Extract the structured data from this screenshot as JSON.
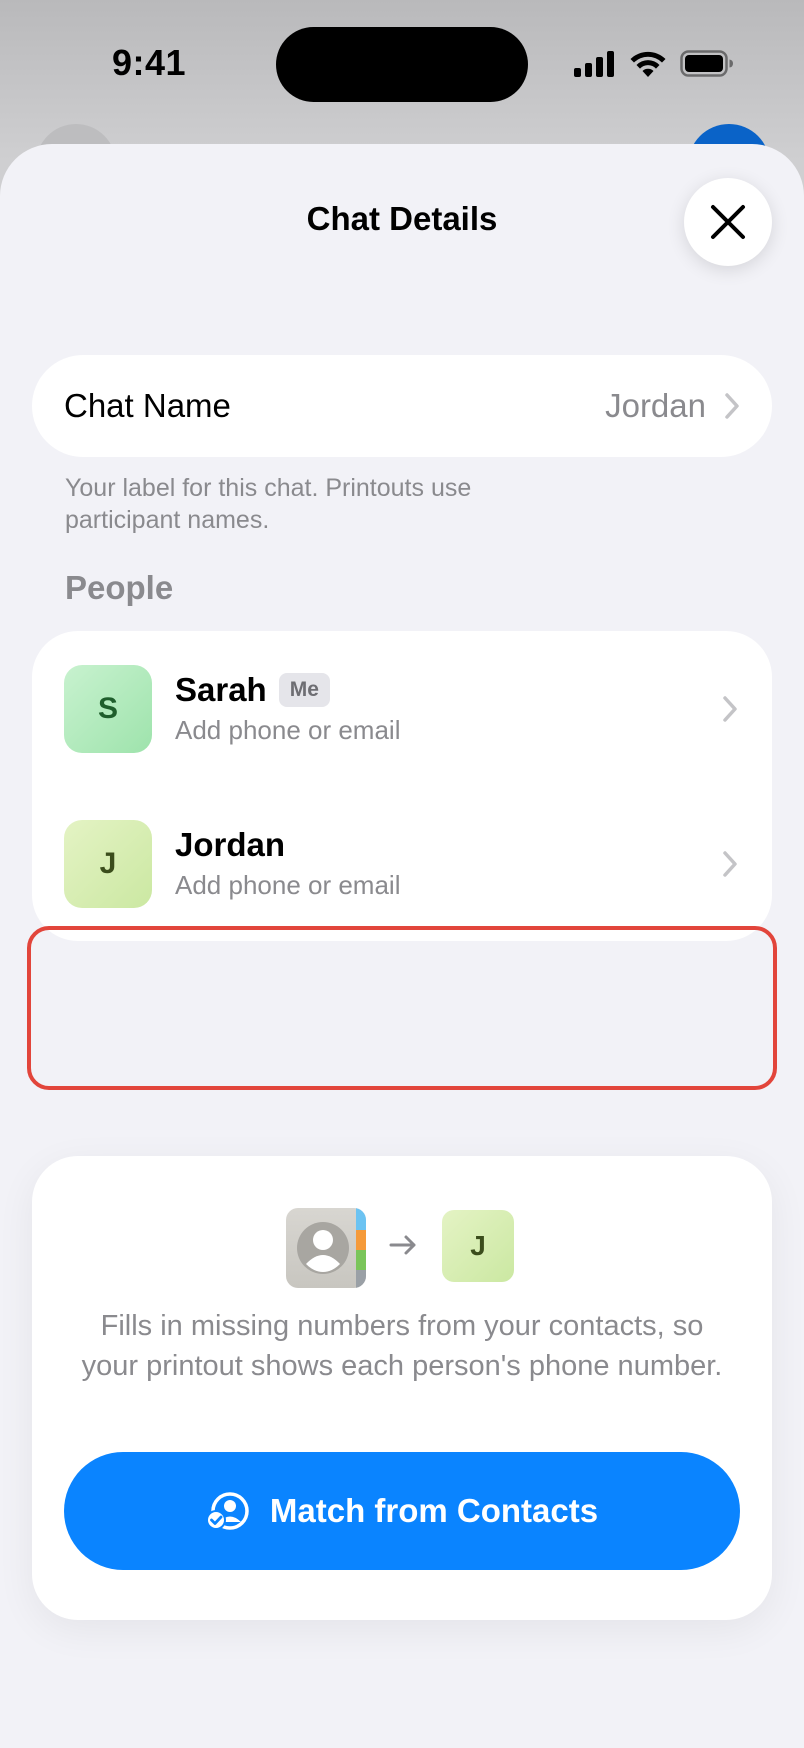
{
  "status_bar": {
    "time": "9:41"
  },
  "sheet": {
    "title": "Chat Details",
    "close_icon": "xmark-icon"
  },
  "chat_name": {
    "label": "Chat Name",
    "value": "Jordan",
    "footnote": "Your label for this chat. Printouts use participant names."
  },
  "people": {
    "header": "People",
    "items": [
      {
        "initial": "S",
        "name": "Sarah",
        "badge": "Me",
        "subtitle": "Add phone or email"
      },
      {
        "initial": "J",
        "name": "Jordan",
        "badge": "",
        "subtitle": "Add phone or email"
      }
    ]
  },
  "match": {
    "target_initial": "J",
    "description": "Fills in missing numbers from your contacts, so your printout shows each person's phone number.",
    "button_label": "Match from Contacts",
    "button_icon": "person-checkmark-icon"
  },
  "colors": {
    "accent": "#0a84ff",
    "highlight": "#e2453b",
    "background": "#f2f2f7"
  }
}
